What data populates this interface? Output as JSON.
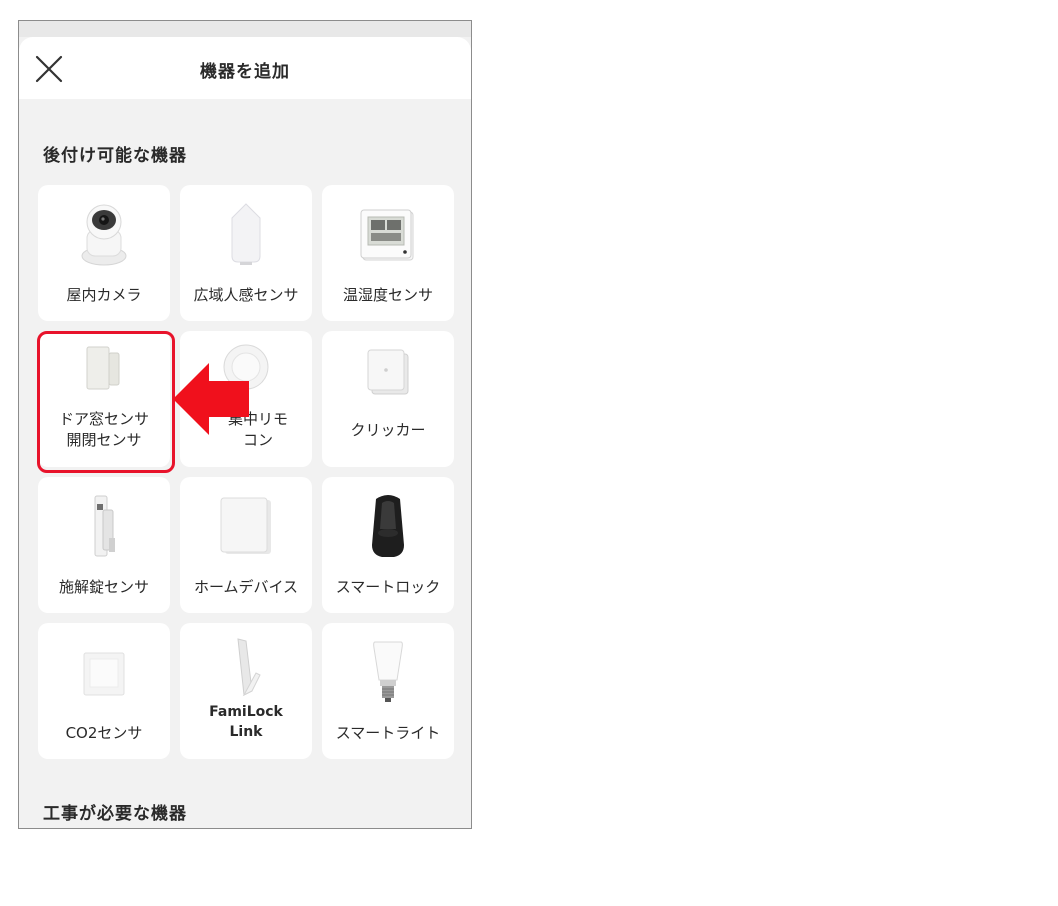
{
  "header": {
    "title": "機器を追加"
  },
  "sections": [
    {
      "title": "後付け可能な機器"
    },
    {
      "title": "工事が必要な機器"
    }
  ],
  "devices": [
    {
      "label": "屋内カメラ",
      "icon": "indoor-camera-icon"
    },
    {
      "label": "広域人感センサ",
      "icon": "motion-sensor-icon"
    },
    {
      "label": "温湿度センサ",
      "icon": "thermo-hygrometer-icon"
    },
    {
      "label": "ドア窓センサ\n開閉センサ",
      "icon": "door-window-sensor-icon"
    },
    {
      "label": "集中リモ\nコン",
      "icon": "remote-control-icon"
    },
    {
      "label": "クリッカー",
      "icon": "clicker-icon"
    },
    {
      "label": "施解錠センサ",
      "icon": "lock-sensor-icon"
    },
    {
      "label": "ホームデバイス",
      "icon": "home-device-icon"
    },
    {
      "label": "スマートロック",
      "icon": "smart-lock-icon"
    },
    {
      "label": "CO2センサ",
      "icon": "co2-sensor-icon"
    },
    {
      "label": "FamiLock\nLink",
      "icon": "familock-link-icon"
    },
    {
      "label": "スマートライト",
      "icon": "smart-light-icon"
    }
  ],
  "annotation": {
    "highlight_color": "#e8132b",
    "arrow_color": "#f0101c"
  }
}
